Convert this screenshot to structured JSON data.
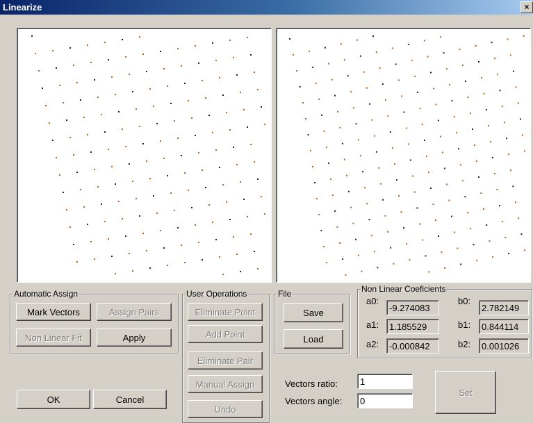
{
  "window": {
    "title": "Linearize",
    "close_glyph": "×"
  },
  "automatic_assign": {
    "legend": "Automatic Assign",
    "mark_vectors": "Mark Vectors",
    "assign_pairs": "Assign Pairs",
    "non_linear_fit": "Non Linear Fit",
    "apply": "Apply"
  },
  "user_operations": {
    "legend": "User Operations",
    "eliminate_point": "Eliminate Point",
    "add_point": "Add Point",
    "eliminate_pair": "Eliminate Pair",
    "manual_assign": "Manual Assign",
    "undo": "Undo"
  },
  "file": {
    "legend": "File",
    "save": "Save",
    "load": "Load"
  },
  "coefficients": {
    "legend": "Non Linear Coeficients",
    "a0_label": "a0:",
    "a0": "-9.274083",
    "a1_label": "a1:",
    "a1": "1.185529",
    "a2_label": "a2:",
    "a2": "-0.000842",
    "b0_label": "b0:",
    "b0": "2.782149",
    "b1_label": "b1:",
    "b1": "0.844114",
    "b2_label": "b2:",
    "b2": "0.001026"
  },
  "vectors": {
    "ratio_label": "Vectors ratio:",
    "ratio": "1",
    "angle_label": "Vectors angle:",
    "angle": "0",
    "set": "Set"
  },
  "dialog": {
    "ok": "OK",
    "cancel": "Cancel"
  },
  "colors": {
    "point": "#c06010",
    "point_dark": "#202020"
  }
}
